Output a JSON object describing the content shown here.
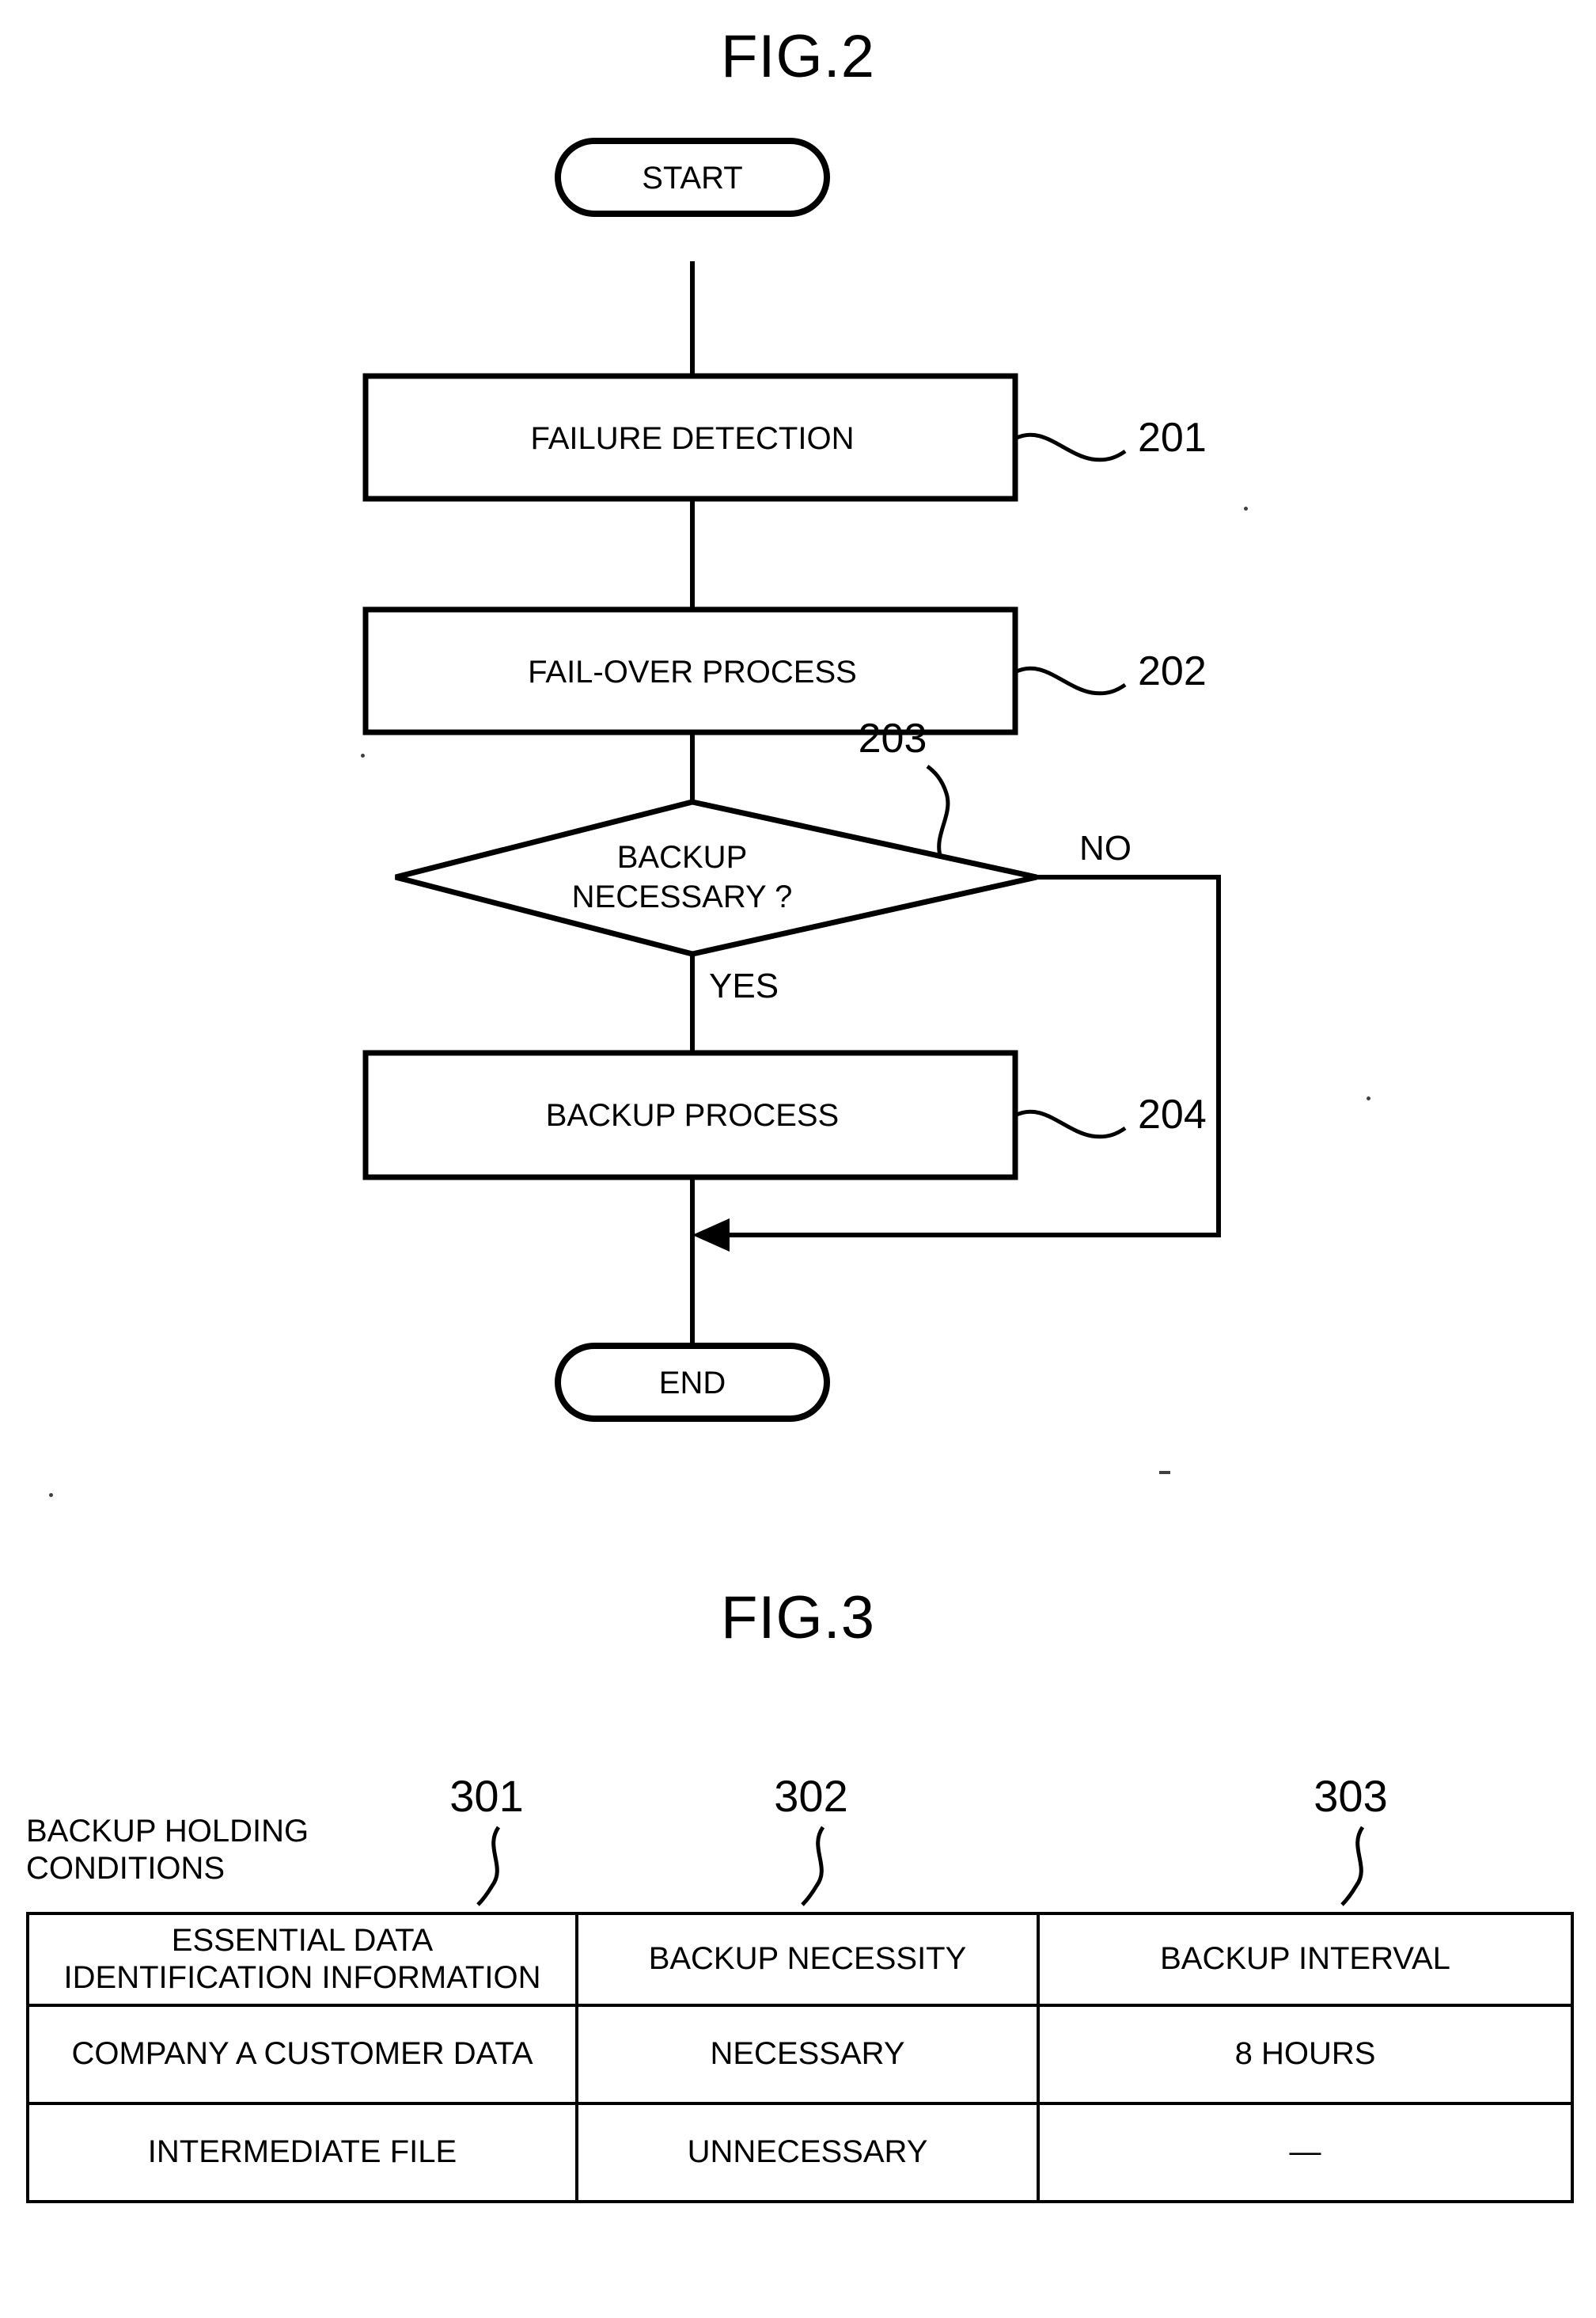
{
  "figures": {
    "fig2": {
      "title": "FIG.2",
      "nodes": {
        "start": "START",
        "failure_detection": "FAILURE DETECTION",
        "failover_process": "FAIL-OVER PROCESS",
        "decision_line1": "BACKUP",
        "decision_line2": "NECESSARY ?",
        "backup_process": "BACKUP PROCESS",
        "end": "END"
      },
      "refs": {
        "failure_detection": "201",
        "failover_process": "202",
        "decision": "203",
        "backup_process": "204"
      },
      "branches": {
        "no": "NO",
        "yes": "YES"
      }
    },
    "fig3": {
      "title": "FIG.3",
      "table_label": "BACKUP HOLDING\nCONDITIONS",
      "column_refs": {
        "essential_data": "301",
        "backup_necessity": "302",
        "backup_interval": "303"
      },
      "table": {
        "headers": [
          "ESSENTIAL DATA\nIDENTIFICATION INFORMATION",
          "BACKUP NECESSITY",
          "BACKUP INTERVAL"
        ],
        "rows": [
          {
            "essential_data": "COMPANY A CUSTOMER DATA",
            "backup_necessity": "NECESSARY",
            "backup_interval": "8 HOURS"
          },
          {
            "essential_data": "INTERMEDIATE FILE",
            "backup_necessity": "UNNECESSARY",
            "backup_interval": "—"
          }
        ]
      }
    }
  }
}
